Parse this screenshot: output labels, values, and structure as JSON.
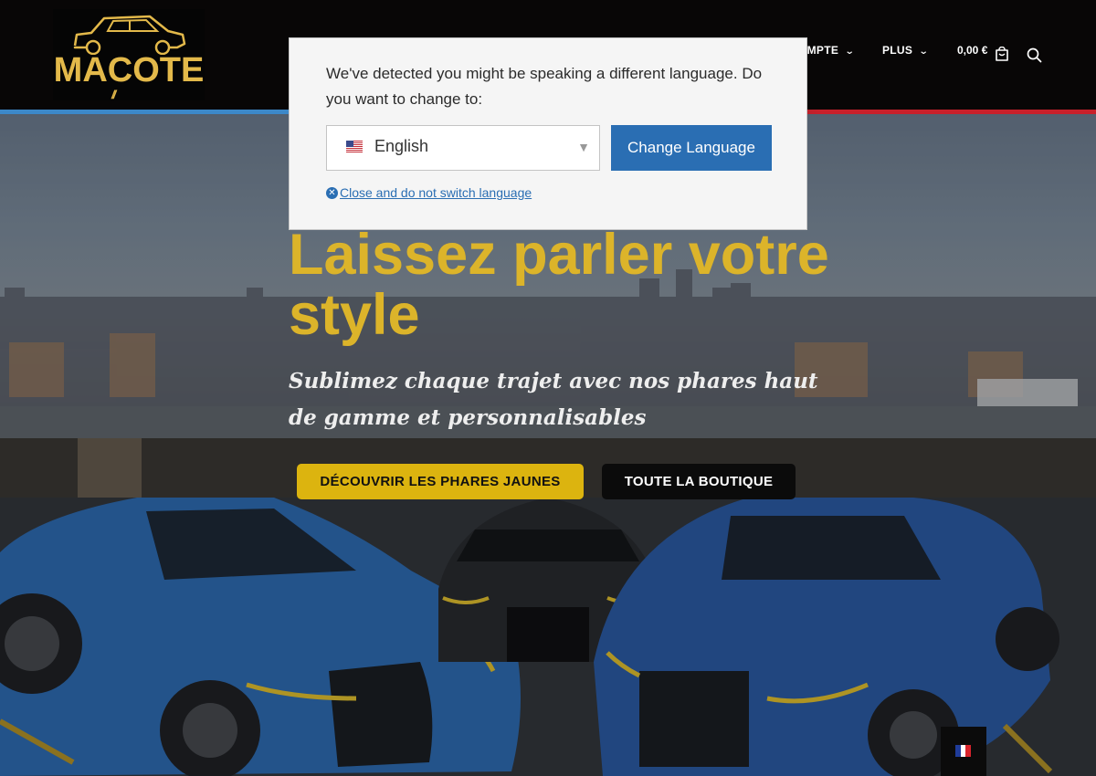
{
  "header": {
    "logo_text": "MACOTE",
    "logo_mark": "//",
    "nav": [
      {
        "label": "OMPTE"
      },
      {
        "label": "PLUS"
      }
    ],
    "cart_amount": "0,00 €",
    "icons": [
      "cart-icon",
      "search-icon",
      "chevron-down-icon"
    ]
  },
  "hero": {
    "title": "Laissez parler votre style",
    "subtitle": "Sublimez chaque trajet avec nos phares haut de gamme et personnalisables",
    "cta_primary": "DÉCOUVRIR LES PHARES JAUNES",
    "cta_secondary": "TOUTE LA BOUTIQUE"
  },
  "language_popup": {
    "message": "We've detected you might be speaking a different language. Do you want to change to:",
    "selected_language": "English",
    "change_button": "Change Language",
    "close_link": "Close and do not switch language"
  },
  "language_switcher": {
    "current": "fr-flag"
  },
  "colors": {
    "header_bg": "#080606",
    "accent_yellow": "#dcb40f",
    "title_yellow": "#dcb42a",
    "popup_button_blue": "#2a6eb3",
    "stripe_blue": "#3c88c8",
    "stripe_red": "#c8202a"
  }
}
